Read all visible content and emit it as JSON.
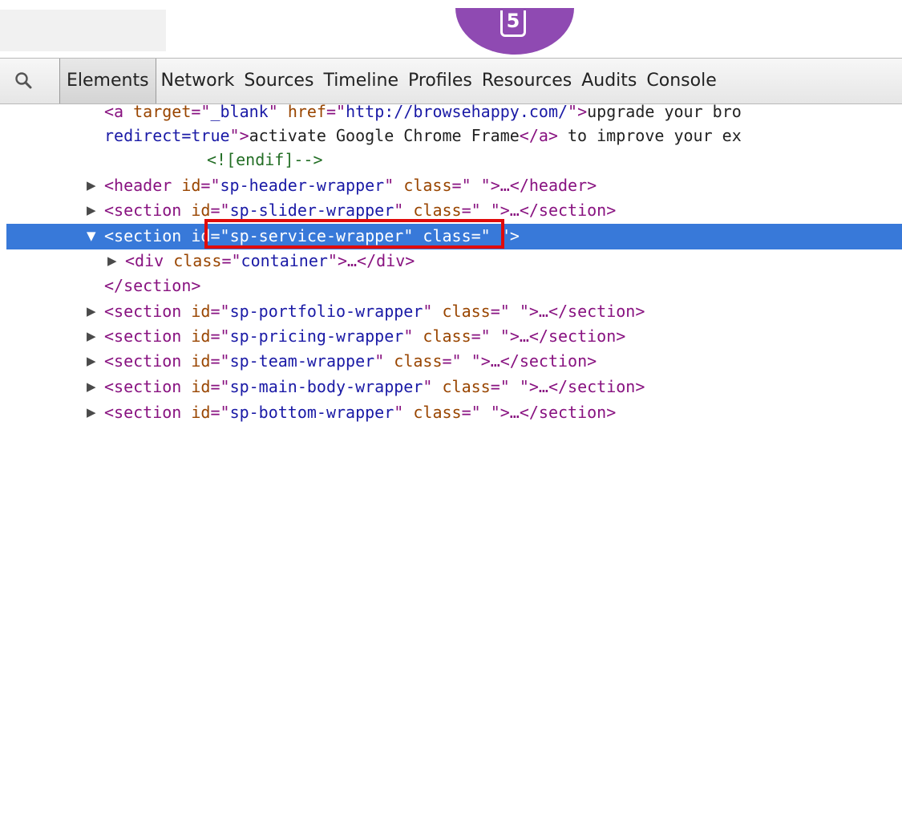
{
  "toolbar": {
    "tabs": [
      {
        "label": "Elements",
        "selected": true
      },
      {
        "label": "Network"
      },
      {
        "label": "Sources"
      },
      {
        "label": "Timeline"
      },
      {
        "label": "Profiles"
      },
      {
        "label": "Resources"
      },
      {
        "label": "Audits"
      },
      {
        "label": "Console"
      }
    ],
    "icons": {
      "search": "search-icon"
    }
  },
  "badge": {
    "logo": "html5-logo-icon",
    "glyph": "5"
  },
  "tree": {
    "line0": {
      "a": "<a ",
      "b": "target",
      "c": "=\"",
      "d": "_blank",
      "e": "\" ",
      "f": "href",
      "g": "=\"",
      "h": "http://browsehappy.com/",
      "i": "\">",
      "j": "upgrade your bro"
    },
    "line1": {
      "a": "redirect=true",
      "b": "\">",
      "c": "activate Google Chrome Frame",
      "d": "</a>",
      "e": " to improve your ex"
    },
    "line2": {
      "a": "<![endif]-->"
    },
    "rows": [
      {
        "open": "<header ",
        "id_attr": "id",
        "id_val": "sp-header-wrapper",
        "class_attr": "class",
        "class_val": " ",
        "close": ">…</header>"
      },
      {
        "open": "<section ",
        "id_attr": "id",
        "id_val": "sp-slider-wrapper",
        "class_attr": "class",
        "class_val": " ",
        "close": ">…</section>"
      },
      {
        "open": "<section ",
        "id_attr": "id",
        "id_val": "sp-service-wrapper",
        "class_attr": "class",
        "class_val": " ",
        "close": ">"
      },
      {
        "open": "<div ",
        "class_attr": "class",
        "class_val": "container",
        "close": ">…</div>"
      },
      {
        "close_tag": "</section>"
      },
      {
        "open": "<section ",
        "id_attr": "id",
        "id_val": "sp-portfolio-wrapper",
        "class_attr": "class",
        "class_val": " ",
        "close": ">…</section>"
      },
      {
        "open": "<section ",
        "id_attr": "id",
        "id_val": "sp-pricing-wrapper",
        "class_attr": "class",
        "class_val": " ",
        "close": ">…</section>"
      },
      {
        "open": "<section ",
        "id_attr": "id",
        "id_val": "sp-team-wrapper",
        "class_attr": "class",
        "class_val": " ",
        "close": ">…</section>"
      },
      {
        "open": "<section ",
        "id_attr": "id",
        "id_val": "sp-main-body-wrapper",
        "class_attr": "class",
        "class_val": " ",
        "close": ">…</section>"
      },
      {
        "open": "<section ",
        "id_attr": "id",
        "id_val": "sp-bottom-wrapper",
        "class_attr": "class",
        "class_val": " ",
        "close": ">…</section>"
      }
    ],
    "selected_index": 2
  },
  "colors": {
    "selection": "#3879d9",
    "highlight_border": "#e00b0b",
    "tag": "#881280",
    "attribute": "#994500",
    "value": "#1a1aa6",
    "badge": "#8f4ab2"
  }
}
